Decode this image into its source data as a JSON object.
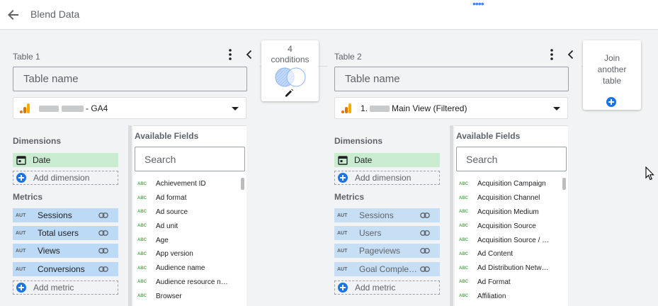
{
  "header": {
    "title": "Blend Data",
    "drag_handle": "••••"
  },
  "table1": {
    "title": "Table 1",
    "table_name_placeholder": "Table name",
    "source_suffix": "- GA4",
    "dimensions_label": "Dimensions",
    "dimensions": [
      "Date"
    ],
    "add_dimension_label": "Add dimension",
    "metrics_label": "Metrics",
    "metrics": [
      {
        "badge": "AUT",
        "label": "Sessions"
      },
      {
        "badge": "AUT",
        "label": "Total users"
      },
      {
        "badge": "AUT",
        "label": "Views"
      },
      {
        "badge": "AUT",
        "label": "Conversions"
      }
    ],
    "add_metric_label": "Add metric",
    "available_fields_label": "Available Fields",
    "search_placeholder": "Search",
    "fields": [
      "Achievement ID",
      "Ad format",
      "Ad source",
      "Ad unit",
      "Age",
      "App version",
      "Audience name",
      "Audience resource n…",
      "Browser"
    ]
  },
  "table2": {
    "title": "Table 2",
    "table_name_placeholder": "Table name",
    "source_prefix": "1.",
    "source_suffix": "Main View (Filtered)",
    "dimensions_label": "Dimensions",
    "dimensions": [
      "Date"
    ],
    "add_dimension_label": "Add dimension",
    "metrics_label": "Metrics",
    "metrics": [
      {
        "badge": "AUT",
        "label": "Sessions"
      },
      {
        "badge": "AUT",
        "label": "Users"
      },
      {
        "badge": "AUT",
        "label": "Pageviews"
      },
      {
        "badge": "AUT",
        "label": "Goal Comple…"
      }
    ],
    "add_metric_label": "Add metric",
    "available_fields_label": "Available Fields",
    "search_placeholder": "Search",
    "fields": [
      "Acquisition Campaign",
      "Acquisition Channel",
      "Acquisition Medium",
      "Acquisition Source",
      "Acquisition Source / …",
      "Ad Content",
      "Ad Distribution Netw…",
      "Ad Format",
      "Affiliation"
    ]
  },
  "join_conditions": {
    "count": "4",
    "label": "conditions"
  },
  "join_another": {
    "line1": "Join",
    "line2": "another",
    "line3": "table"
  },
  "field_type_badge": "ABC",
  "colors": {
    "accent": "#1a73e8",
    "dimension_chip": "#c9ecd1",
    "metric_chip": "#bcdaf6",
    "ga_orange": "#f9ab00",
    "ga_dark_orange": "#e37400"
  }
}
